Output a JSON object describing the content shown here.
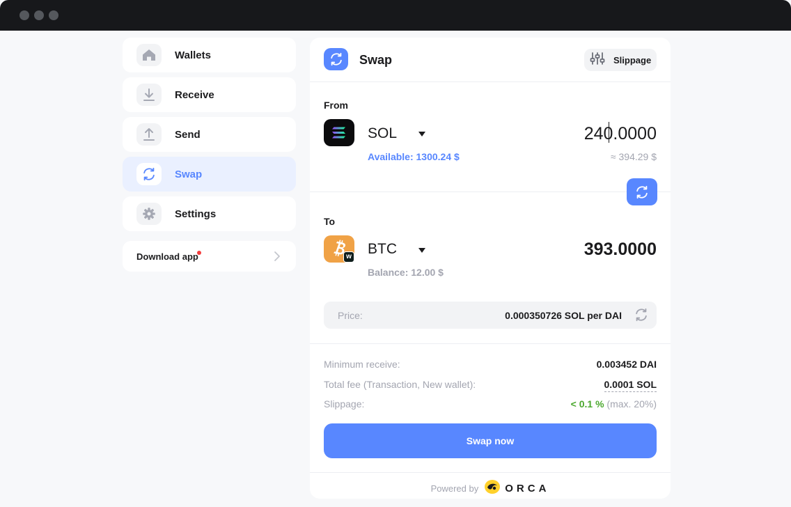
{
  "sidebar": {
    "items": [
      {
        "label": "Wallets",
        "icon": "home-icon"
      },
      {
        "label": "Receive",
        "icon": "download-icon"
      },
      {
        "label": "Send",
        "icon": "upload-icon"
      },
      {
        "label": "Swap",
        "icon": "swap-icon",
        "active": true
      },
      {
        "label": "Settings",
        "icon": "gear-icon"
      }
    ],
    "download_app": "Download app"
  },
  "header": {
    "title": "Swap",
    "slippage_label": "Slippage"
  },
  "from": {
    "label": "From",
    "token": "SOL",
    "amount": "240.0000",
    "available": "Available: 1300.24 $",
    "approx": "≈ 394.29 $"
  },
  "to": {
    "label": "To",
    "token": "BTC",
    "amount": "393.0000",
    "balance": "Balance: 12.00 $",
    "badge": "w"
  },
  "price": {
    "label": "Price:",
    "value": "0.000350726 SOL per DAI"
  },
  "details": {
    "min_receive_label": "Minimum receive:",
    "min_receive_value": "0.003452 DAI",
    "fee_label": "Total fee (Transaction, New wallet):",
    "fee_value": "0.0001 SOL",
    "slippage_label": "Slippage:",
    "slippage_value": "< 0.1 %",
    "slippage_max": "(max. 20%)"
  },
  "swap_button": "Swap now",
  "footer": {
    "powered_by": "Powered by",
    "brand": "ORCA"
  },
  "colors": {
    "accent": "#5887ff",
    "active_bg": "#eaf0ff",
    "green": "#4ba82e",
    "btc": "#f7931a"
  }
}
